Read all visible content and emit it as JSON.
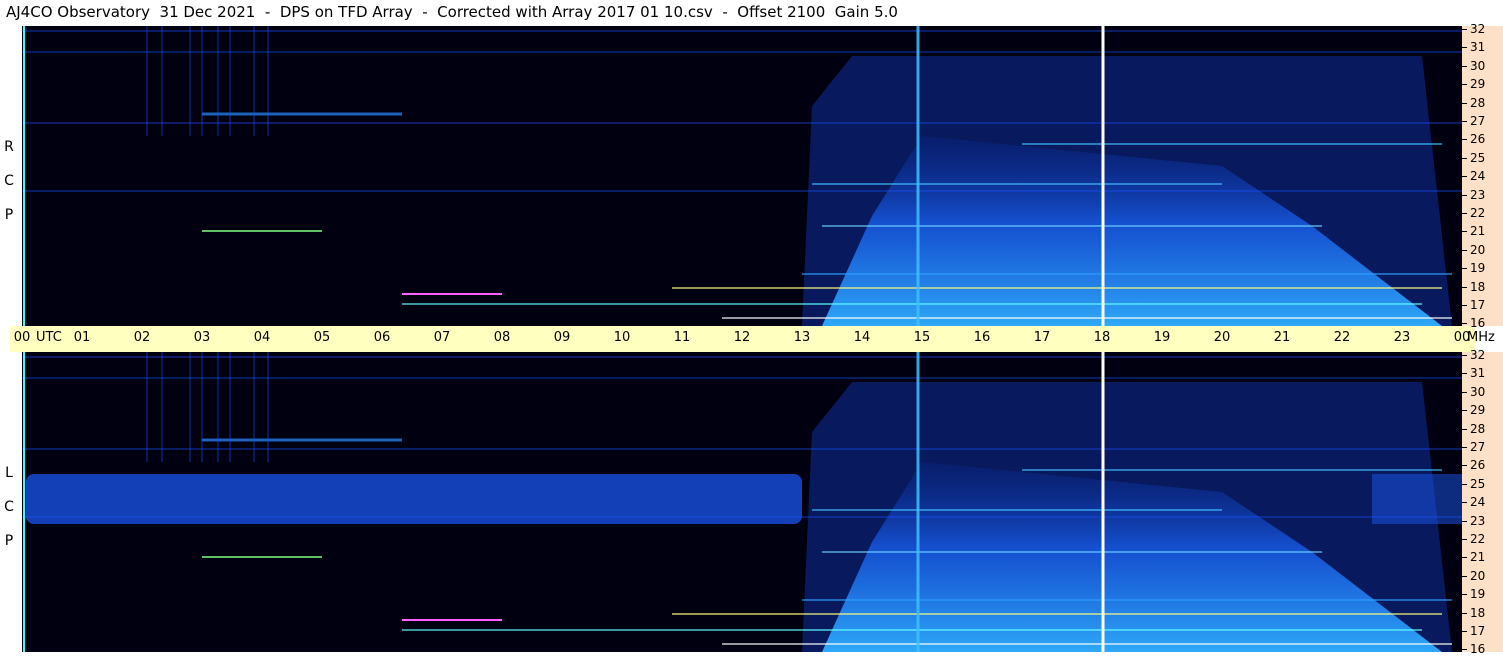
{
  "title": "AJ4CO Observatory  31 Dec 2021  -  DPS on TFD Array  -  Corrected with Array 2017 01 10.csv  -  Offset 2100  Gain 5.0",
  "panels": [
    {
      "polarization": [
        "R",
        "C",
        "P"
      ]
    },
    {
      "polarization": [
        "L",
        "C",
        "P"
      ]
    }
  ],
  "time_axis": {
    "ticks": [
      "00",
      "01",
      "02",
      "03",
      "04",
      "05",
      "06",
      "07",
      "08",
      "09",
      "10",
      "11",
      "12",
      "13",
      "14",
      "15",
      "16",
      "17",
      "18",
      "19",
      "20",
      "21",
      "22",
      "23",
      "00"
    ],
    "utc_label": "UTC",
    "unit_label": "MHz"
  },
  "freq_axis": {
    "ticks": [
      "32",
      "31",
      "30",
      "29",
      "28",
      "27",
      "26",
      "25",
      "24",
      "23",
      "22",
      "21",
      "20",
      "19",
      "18",
      "17",
      "16"
    ]
  },
  "chart_data": {
    "type": "heatmap",
    "title": "AJ4CO Observatory  31 Dec 2021  -  DPS on TFD Array  -  Corrected with Array 2017 01 10.csv  -  Offset 2100  Gain 5.0",
    "x_unit": "UTC",
    "y_unit": "MHz",
    "xlim": [
      0,
      24
    ],
    "ylim": [
      16,
      32
    ],
    "panels": [
      "RCP",
      "LCP"
    ],
    "colormap": [
      "#000010",
      "#0a2a9a",
      "#1a66ff",
      "#22c0ff",
      "#ffff40",
      "#ff40ff",
      "#ffffff"
    ],
    "background_color": "#000010",
    "axis_colors": {
      "time": "#ffffc0",
      "frequency": "#fde0c8"
    }
  }
}
